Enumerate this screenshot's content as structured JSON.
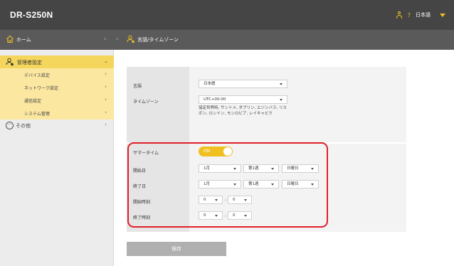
{
  "header": {
    "product": "DR-S250N",
    "help": "?",
    "language": "日本語"
  },
  "breadcrumb": {
    "home": "ホーム",
    "current": "言語/タイムゾーン"
  },
  "sidebar": {
    "group": "管理者設定",
    "items": [
      {
        "label": "デバイス設定"
      },
      {
        "label": "ネットワーク設定"
      },
      {
        "label": "通信設定"
      },
      {
        "label": "システム管理"
      }
    ],
    "other": "その他"
  },
  "form": {
    "language": {
      "label": "言語",
      "value": "日本語"
    },
    "timezone": {
      "label": "タイムゾーン",
      "value": "UTC+00:00",
      "note": "協定世界時, サントメ, ダブリン, エジンバラ, リスボン, ロンドン, モンロビア, レイキャビク"
    },
    "dst": {
      "label": "サマータイム",
      "value": "ON"
    },
    "start_date": {
      "label": "開始日",
      "month": "1月",
      "week": "第1週",
      "day": "日曜日"
    },
    "end_date": {
      "label": "終了日",
      "month": "1月",
      "week": "第1週",
      "day": "日曜日"
    },
    "start_time": {
      "label": "開始時刻",
      "hour": "0",
      "minute": "0"
    },
    "end_time": {
      "label": "終了時刻",
      "hour": "0",
      "minute": "0"
    },
    "colon": ":"
  },
  "save_label": "保存",
  "colors": {
    "accent": "#f0c020",
    "highlight": "#e0202a",
    "topbar": "#454545"
  }
}
